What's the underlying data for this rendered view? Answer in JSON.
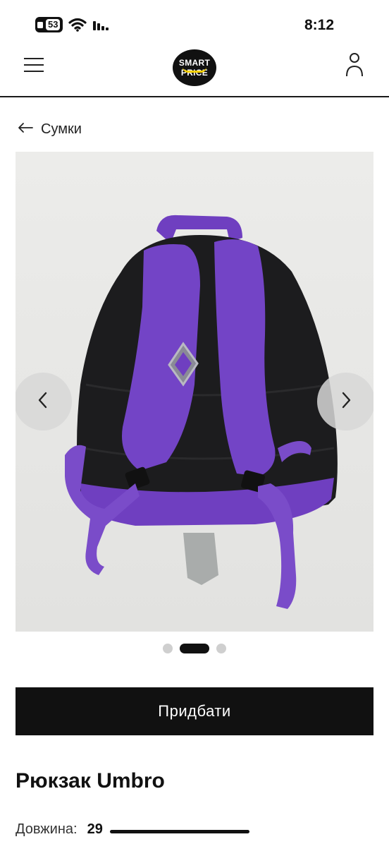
{
  "status_bar": {
    "sim_label": "53",
    "time": "8:12"
  },
  "header": {
    "logo_line1": "SMART",
    "logo_line2": "PRICE",
    "icons": [
      "menu-icon",
      "user-icon"
    ]
  },
  "breadcrumb": {
    "back_label": "Сумки",
    "icon": "arrow-left-icon"
  },
  "gallery": {
    "image_subject": "purple and black backpack, back view",
    "slide_count": 3,
    "active_slide": 2,
    "prev_icon": "chevron-left-icon",
    "next_icon": "chevron-right-icon"
  },
  "actions": {
    "buy_label": "Придбати"
  },
  "product": {
    "title": "Рюкзак Umbro",
    "specs": [
      {
        "label": "Довжина:",
        "value": "29"
      }
    ]
  },
  "colors": {
    "primary": "#111111",
    "accent_logo": "#f5d000",
    "backpack_purple": "#6f3fc0"
  }
}
